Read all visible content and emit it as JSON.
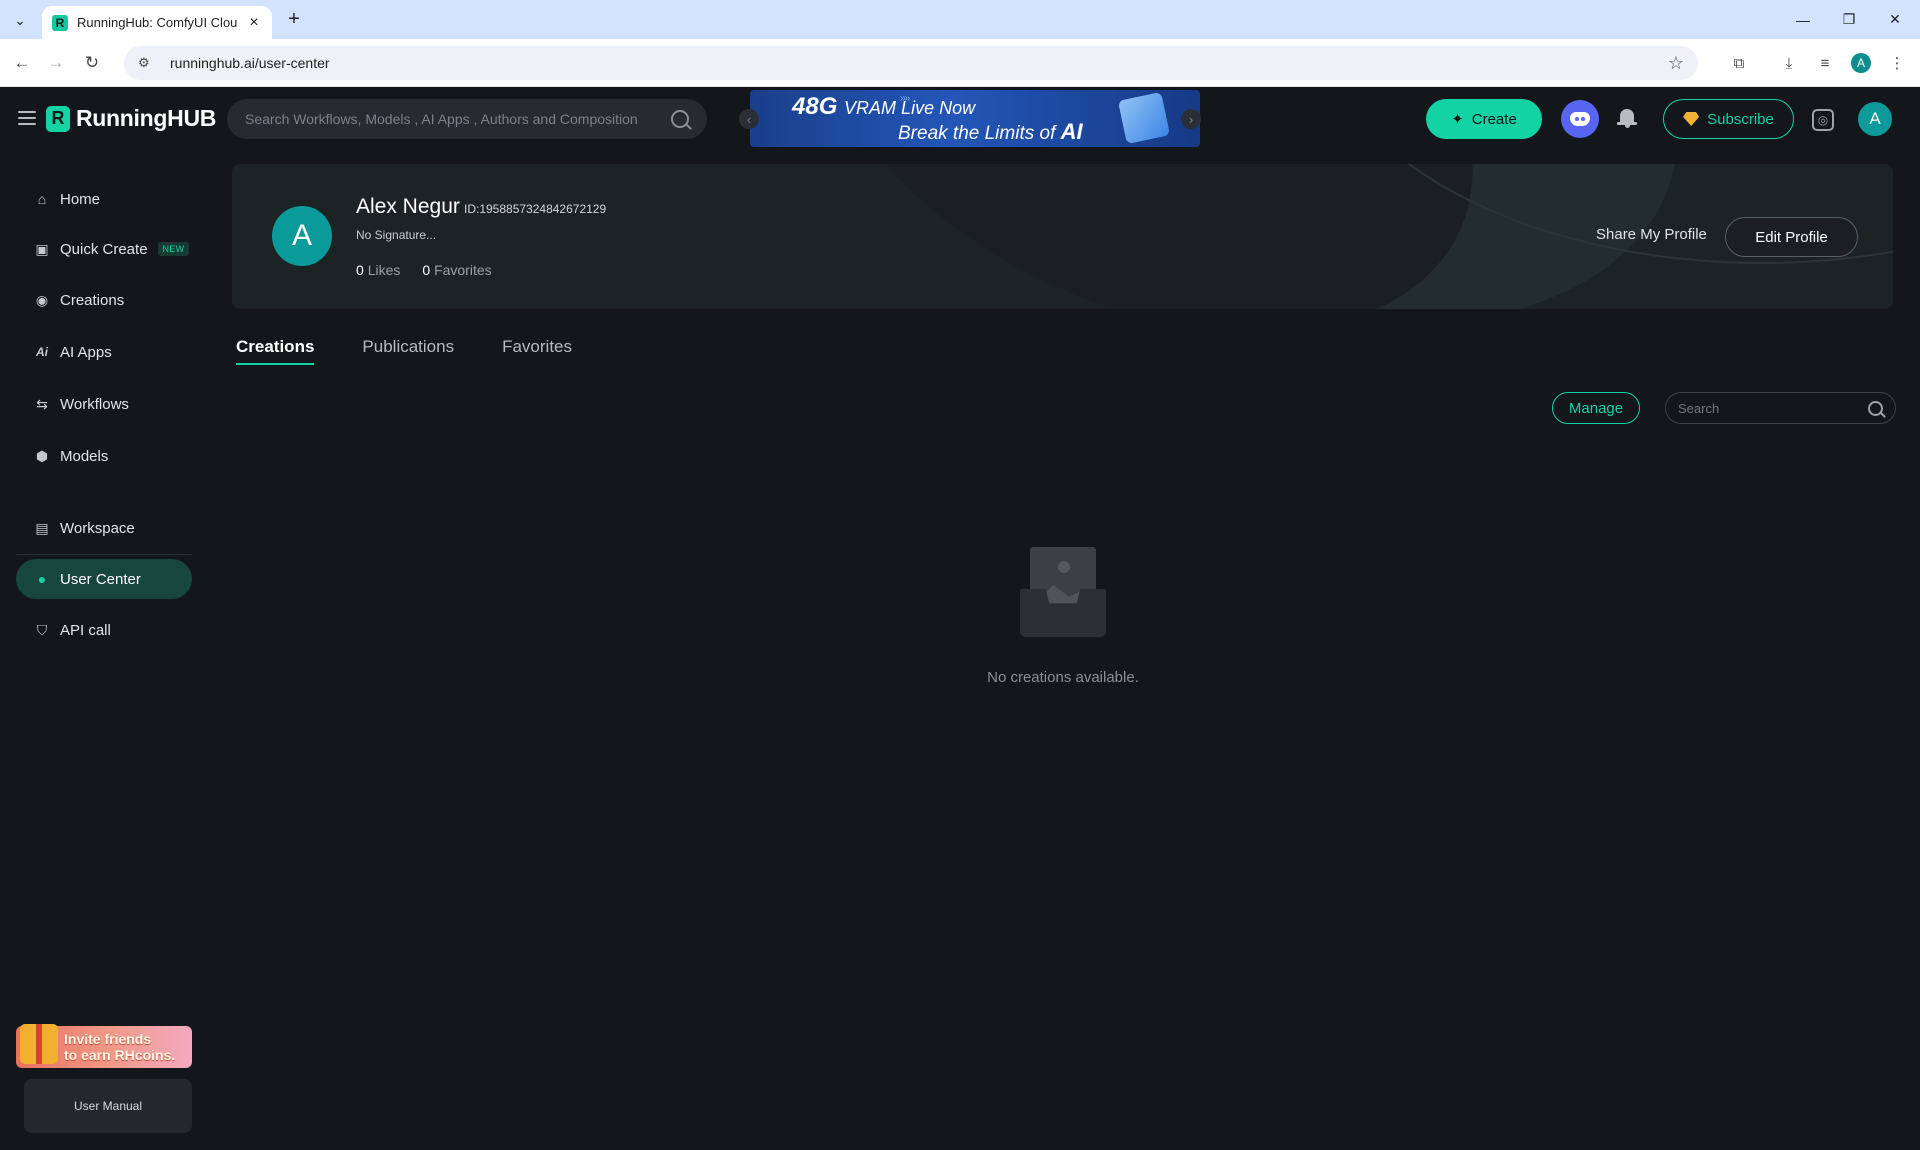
{
  "browser": {
    "tab_title": "RunningHub: ComfyUI Cloud, C",
    "url": "runninghub.ai/user-center",
    "profile_initial": "A"
  },
  "header": {
    "logo_text": "RunningHUB",
    "search_placeholder": "Search Workflows, Models , AI Apps , Authors and Composition",
    "banner": {
      "big": "48G",
      "line1": "VRAM Live Now",
      "line2": "Break the Limits of",
      "line2_emph": "AI"
    },
    "create_label": "Create",
    "subscribe_label": "Subscribe",
    "avatar_initial": "A"
  },
  "sidebar": {
    "items": [
      {
        "label": "Home",
        "icon": "home-icon"
      },
      {
        "label": "Quick Create",
        "icon": "quick-create-icon",
        "badge": "NEW"
      },
      {
        "label": "Creations",
        "icon": "creations-icon"
      },
      {
        "label": "AI Apps",
        "icon": "ai-apps-icon"
      },
      {
        "label": "Workflows",
        "icon": "workflows-icon"
      },
      {
        "label": "Models",
        "icon": "models-icon"
      },
      {
        "label": "Workspace",
        "icon": "workspace-icon"
      },
      {
        "label": "User Center",
        "icon": "user-icon",
        "active": true
      },
      {
        "label": "API call",
        "icon": "api-icon"
      }
    ],
    "invite_line1": "Invite friends",
    "invite_line2": "to earn RHcoins.",
    "manual_label": "User Manual"
  },
  "profile": {
    "initial": "A",
    "name": "Alex Negur",
    "id": "ID:1958857324842672129",
    "signature": "No Signature...",
    "likes_count": "0",
    "likes_label": "Likes",
    "favorites_count": "0",
    "favorites_label": "Favorites",
    "share_label": "Share My Profile",
    "edit_label": "Edit Profile"
  },
  "tabs": [
    {
      "label": "Creations",
      "active": true
    },
    {
      "label": "Publications"
    },
    {
      "label": "Favorites"
    }
  ],
  "content": {
    "manage_label": "Manage",
    "search_placeholder": "Search",
    "empty_text": "No creations available."
  },
  "colors": {
    "accent": "#13d2a4",
    "background": "#13161b",
    "active_nav": "#16463d",
    "discord": "#5865f2"
  }
}
